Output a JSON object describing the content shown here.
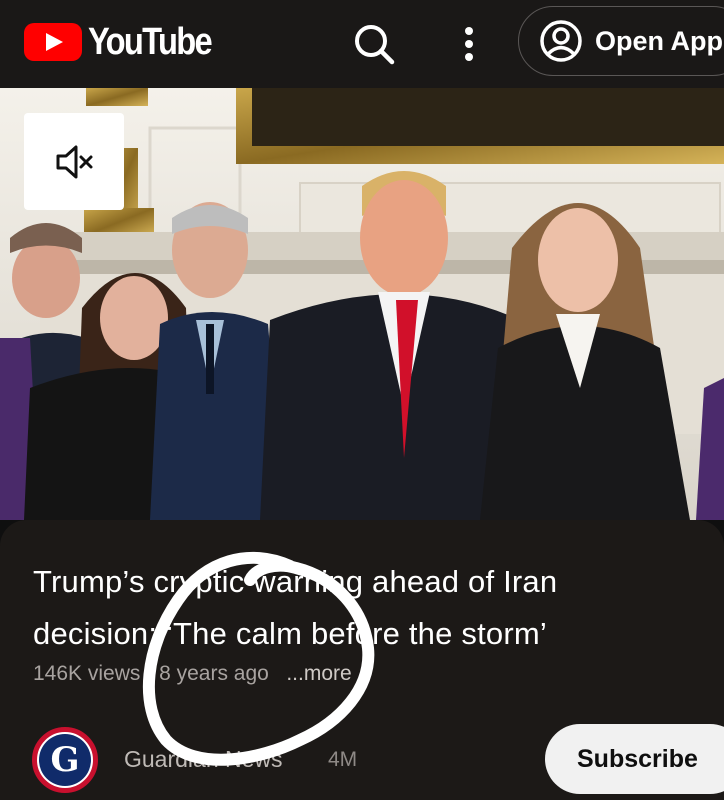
{
  "header": {
    "logo_text": "YouTube",
    "open_app_label": "Open App",
    "icons": [
      "youtube-play-icon",
      "search-icon",
      "more-vert-icon",
      "account-circle-icon"
    ]
  },
  "player": {
    "mute_icon": "volume-off-icon"
  },
  "video": {
    "title": "Trump’s cryptic warning ahead of Iran decision: ‘The calm before the storm’",
    "views": "146K views",
    "separator": "·",
    "age": "8 years ago",
    "more_label": "...more"
  },
  "channel": {
    "avatar_letter": "G",
    "name": "Guardian News",
    "subscribers": "4M",
    "subscribe_label": "Subscribe"
  },
  "colors": {
    "brand_red": "#ff0000",
    "background": "#0f0f0f",
    "card": "#1c1917",
    "subscribe_bg": "#f1f1f1"
  }
}
